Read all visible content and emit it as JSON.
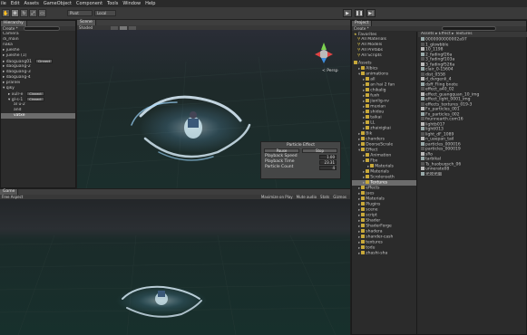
{
  "menu": [
    "ile",
    "Edit",
    "Assets",
    "GameObject",
    "Component",
    "Tools",
    "Window",
    "Help"
  ],
  "toolbar": {
    "pivot_label": "Pivot",
    "local_label": "Local",
    "play_icon": "play-icon",
    "pause_icon": "pause-icon",
    "step_icon": "step-icon"
  },
  "hierarchy": {
    "tab": "Hierarchy",
    "create": "Create *",
    "items": [
      {
        "label": "Camera",
        "indent": 0
      },
      {
        "label": "di_main",
        "indent": 0
      },
      {
        "label": "naka",
        "indent": 0
      },
      {
        "label": "▸ jueshe",
        "indent": 0
      },
      {
        "label": "▸ jueshe (1)",
        "indent": 0
      },
      {
        "label": "▸ daoguang01",
        "indent": 0,
        "badge": "Cinnect"
      },
      {
        "label": "▸ daoguang-2",
        "indent": 0
      },
      {
        "label": "▸ daoguang-3",
        "indent": 0
      },
      {
        "label": "▸ daoguang-4",
        "indent": 0
      },
      {
        "label": "▸ pranlei",
        "indent": 0
      },
      {
        "label": "▾ qiky",
        "indent": 0
      },
      {
        "label": "▸ xulr-e",
        "indent": 1,
        "badge": "Cinnect"
      },
      {
        "label": "▾ gl-s-1",
        "indent": 1,
        "badge": "Cinnect"
      },
      {
        "label": "al u-2",
        "indent": 2
      },
      {
        "label": "and",
        "indent": 2
      },
      {
        "label": "vatxe",
        "indent": 2,
        "selected": true
      }
    ]
  },
  "scene": {
    "tab": "Scene",
    "shaded": "Shaded",
    "persp": "< Persp"
  },
  "particle_effect": {
    "title": "Particle Effect",
    "pause": "Pause",
    "stop": "Stop",
    "rows": [
      {
        "label": "Playback Speed",
        "value": "1.00"
      },
      {
        "label": "Playback Time",
        "value": "23.31"
      },
      {
        "label": "Particle Count",
        "value": "4"
      }
    ]
  },
  "game": {
    "tab": "Game",
    "aspect": "Free Aspect",
    "options": [
      "Maximize on Play",
      "Mute audio",
      "Stats",
      "Gizmos"
    ]
  },
  "project": {
    "tab": "Project",
    "create": "Create *",
    "breadcrumb": "Assets ▸ Effect ▸ Textures",
    "favorites_label": "Favorites",
    "favorites": [
      "All Materials",
      "All Models",
      "All Prefabs",
      "All Scripts"
    ],
    "assets_label": "Assets",
    "tree": [
      {
        "label": "Albics",
        "indent": 1
      },
      {
        "label": "animations",
        "indent": 1,
        "open": true
      },
      {
        "label": "all",
        "indent": 2
      },
      {
        "label": "an hai 2 fan",
        "indent": 2
      },
      {
        "label": "chikalig",
        "indent": 2
      },
      {
        "label": "fuxh",
        "indent": 2
      },
      {
        "label": "jianlig-nv",
        "indent": 2
      },
      {
        "label": "muxian",
        "indent": 2
      },
      {
        "label": "shidou",
        "indent": 2
      },
      {
        "label": "taikai",
        "indent": 2
      },
      {
        "label": "LL",
        "indent": 2
      },
      {
        "label": "zhaixigkai",
        "indent": 2
      },
      {
        "label": "Bik",
        "indent": 1
      },
      {
        "label": "chanders",
        "indent": 1
      },
      {
        "label": "DoorseScrale",
        "indent": 1
      },
      {
        "label": "Effect",
        "indent": 1,
        "open": true
      },
      {
        "label": "Animation",
        "indent": 2
      },
      {
        "label": "Fbx",
        "indent": 2
      },
      {
        "label": "Materials",
        "indent": 3
      },
      {
        "label": "Materials",
        "indent": 2
      },
      {
        "label": "Scrolenseth",
        "indent": 2
      },
      {
        "label": "Textures",
        "indent": 2,
        "selected": true
      },
      {
        "label": "effects",
        "indent": 1
      },
      {
        "label": "jues",
        "indent": 1
      },
      {
        "label": "Materials",
        "indent": 1
      },
      {
        "label": "Plugins",
        "indent": 1
      },
      {
        "label": "scene",
        "indent": 1
      },
      {
        "label": "script",
        "indent": 1
      },
      {
        "label": "Shader",
        "indent": 1
      },
      {
        "label": "ShaderForge",
        "indent": 1
      },
      {
        "label": "shadera",
        "indent": 1
      },
      {
        "label": "shander-cash",
        "indent": 1
      },
      {
        "label": "textures",
        "indent": 1
      },
      {
        "label": "todu",
        "indent": 1
      },
      {
        "label": "zhashi-sha",
        "indent": 1
      }
    ],
    "files": [
      "0000000000002a97",
      "1_glowbble",
      "10_1198",
      "2_fadingf26a",
      "3_fadingf103a",
      "3_fadingf526a",
      "clair_0-15604",
      "dist_0558",
      "d_dvrgenli_4",
      "dsff_Fling bnote",
      "effect_a40_02",
      "effect_guangquan_10_img",
      "effect_light_0001_img",
      "effects_textures_019-3",
      "Fx_particles_001",
      "Fx_particles_002",
      "fxunnearth.com16",
      "lightb017",
      "lightl013",
      "light_dF_1089",
      "n_uaepan_tail",
      "particles_000016",
      "particles_000019",
      "sRo",
      "tarbikal",
      "Ts_huobuqsch_06",
      "unnerate08",
      "光效光圈"
    ]
  },
  "colors": {
    "accent": "#7ab8ff",
    "selection": "#6c6c6c",
    "panel": "#2b2b2b"
  }
}
